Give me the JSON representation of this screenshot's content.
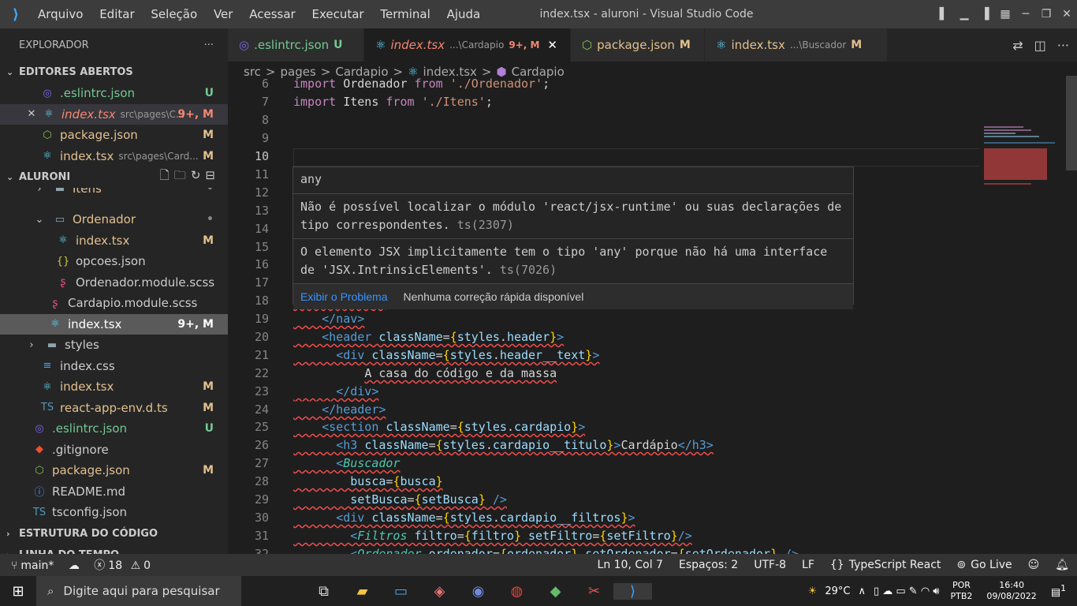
{
  "window": {
    "title": "index.tsx - aluroni - Visual Studio Code",
    "menu": [
      "Arquivo",
      "Editar",
      "Seleção",
      "Ver",
      "Acessar",
      "Executar",
      "Terminal",
      "Ajuda"
    ]
  },
  "sidebar": {
    "header": "EXPLORADOR",
    "open_editors_title": "EDITORES ABERTOS",
    "open_editors": [
      {
        "name": ".eslintrc.json",
        "desc": "",
        "status": "U"
      },
      {
        "name": "index.tsx",
        "desc": "src\\pages\\C...",
        "status": "9+, M"
      },
      {
        "name": "package.json",
        "desc": "",
        "status": "M"
      },
      {
        "name": "index.tsx",
        "desc": "src\\pages\\Card...",
        "status": "M"
      }
    ],
    "project_title": "ALURONI",
    "tree": [
      {
        "name": "Itens",
        "status": "•"
      },
      {
        "name": "Ordenador",
        "status": "•"
      },
      {
        "name": "index.tsx",
        "status": "M"
      },
      {
        "name": "opcoes.json",
        "status": ""
      },
      {
        "name": "Ordenador.module.scss",
        "status": ""
      },
      {
        "name": "Cardapio.module.scss",
        "status": ""
      },
      {
        "name": "index.tsx",
        "status": "9+, M"
      },
      {
        "name": "styles",
        "status": ""
      },
      {
        "name": "index.css",
        "status": ""
      },
      {
        "name": "index.tsx",
        "status": "M"
      },
      {
        "name": "react-app-env.d.ts",
        "status": "M"
      },
      {
        "name": ".eslintrc.json",
        "status": "U"
      },
      {
        "name": ".gitignore",
        "status": ""
      },
      {
        "name": "package.json",
        "status": "M"
      },
      {
        "name": "README.md",
        "status": ""
      },
      {
        "name": "tsconfig.json",
        "status": ""
      }
    ],
    "outline": "ESTRUTURA DO CÓDIGO",
    "timeline": "LINHA DO TEMPO"
  },
  "tabs": [
    {
      "name": ".eslintrc.json",
      "desc": "",
      "status": "U"
    },
    {
      "name": "index.tsx",
      "desc": "...\\Cardapio",
      "status": "9+, M"
    },
    {
      "name": "package.json",
      "desc": "",
      "status": "M"
    },
    {
      "name": "index.tsx",
      "desc": "...\\Buscador",
      "status": "M"
    }
  ],
  "breadcrumb": [
    "src",
    ">",
    "pages",
    ">",
    "Cardapio",
    ">",
    "index.tsx",
    ">",
    "Cardapio"
  ],
  "hover": {
    "title": "any",
    "msg1": "Não é possível localizar o módulo 'react/jsx-runtime' ou suas declarações de tipo correspondentes.",
    "code1": "ts(2307)",
    "msg2": "O elemento JSX implicitamente tem o tipo 'any' porque não há uma interface de 'JSX.IntrinsicElements'.",
    "code2": "ts(7026)",
    "action1": "Exibir o Problema",
    "action2": "Nenhuma correção rápida disponível"
  },
  "status": {
    "branch": "main*",
    "errors": "18",
    "warnings": "0",
    "position": "Ln 10, Col 7",
    "spaces": "Espaços: 2",
    "encoding": "UTF-8",
    "eol": "LF",
    "language": "TypeScript React",
    "golive": "Go Live"
  },
  "taskbar": {
    "search": "Digite aqui para pesquisar",
    "temp": "29°C",
    "lang1": "POR",
    "lang2": "PTB2",
    "time": "16:40",
    "date": "09/08/2022",
    "notif": "1"
  },
  "line_numbers": [
    "6",
    "7",
    "8",
    "9",
    "10",
    "11",
    "12",
    "13",
    "14",
    "15",
    "16",
    "17",
    "18",
    "19",
    "20",
    "21",
    "22",
    "23",
    "24",
    "25",
    "26",
    "27",
    "28",
    "29",
    "30",
    "31",
    "32"
  ]
}
